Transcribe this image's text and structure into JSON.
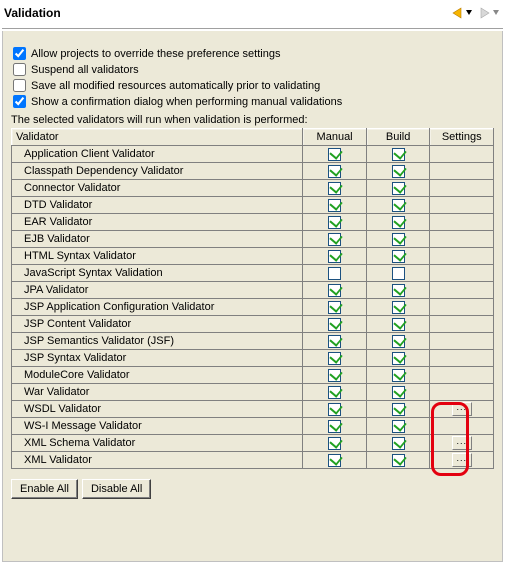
{
  "title": "Validation",
  "options": {
    "allow_override": {
      "label": "Allow projects to override these preference settings",
      "checked": true
    },
    "suspend": {
      "label": "Suspend all validators",
      "checked": false
    },
    "save_modified": {
      "label": "Save all modified resources automatically prior to validating",
      "checked": false
    },
    "confirm_dialog": {
      "label": "Show a confirmation dialog when performing manual validations",
      "checked": true
    }
  },
  "table": {
    "desc": "The selected validators will run when validation is performed:",
    "headers": {
      "validator": "Validator",
      "manual": "Manual",
      "build": "Build",
      "settings": "Settings"
    },
    "rows": [
      {
        "name": "Application Client Validator",
        "manual": true,
        "build": true,
        "settings": false
      },
      {
        "name": "Classpath Dependency Validator",
        "manual": true,
        "build": true,
        "settings": false
      },
      {
        "name": "Connector Validator",
        "manual": true,
        "build": true,
        "settings": false
      },
      {
        "name": "DTD Validator",
        "manual": true,
        "build": true,
        "settings": false
      },
      {
        "name": "EAR Validator",
        "manual": true,
        "build": true,
        "settings": false
      },
      {
        "name": "EJB Validator",
        "manual": true,
        "build": true,
        "settings": false
      },
      {
        "name": "HTML Syntax Validator",
        "manual": true,
        "build": true,
        "settings": false
      },
      {
        "name": "JavaScript Syntax Validation",
        "manual": false,
        "build": false,
        "settings": false
      },
      {
        "name": "JPA Validator",
        "manual": true,
        "build": true,
        "settings": false
      },
      {
        "name": "JSP Application Configuration Validator",
        "manual": true,
        "build": true,
        "settings": false
      },
      {
        "name": "JSP Content Validator",
        "manual": true,
        "build": true,
        "settings": false
      },
      {
        "name": "JSP Semantics Validator (JSF)",
        "manual": true,
        "build": true,
        "settings": false
      },
      {
        "name": "JSP Syntax Validator",
        "manual": true,
        "build": true,
        "settings": false
      },
      {
        "name": "ModuleCore Validator",
        "manual": true,
        "build": true,
        "settings": false
      },
      {
        "name": "War Validator",
        "manual": true,
        "build": true,
        "settings": false
      },
      {
        "name": "WSDL Validator",
        "manual": true,
        "build": true,
        "settings": true
      },
      {
        "name": "WS-I Message Validator",
        "manual": true,
        "build": true,
        "settings": false
      },
      {
        "name": "XML Schema Validator",
        "manual": true,
        "build": true,
        "settings": true
      },
      {
        "name": "XML Validator",
        "manual": true,
        "build": true,
        "settings": true
      }
    ]
  },
  "buttons": {
    "enable_all": "Enable All",
    "disable_all": "Disable All"
  },
  "settings_btn_label": "..."
}
